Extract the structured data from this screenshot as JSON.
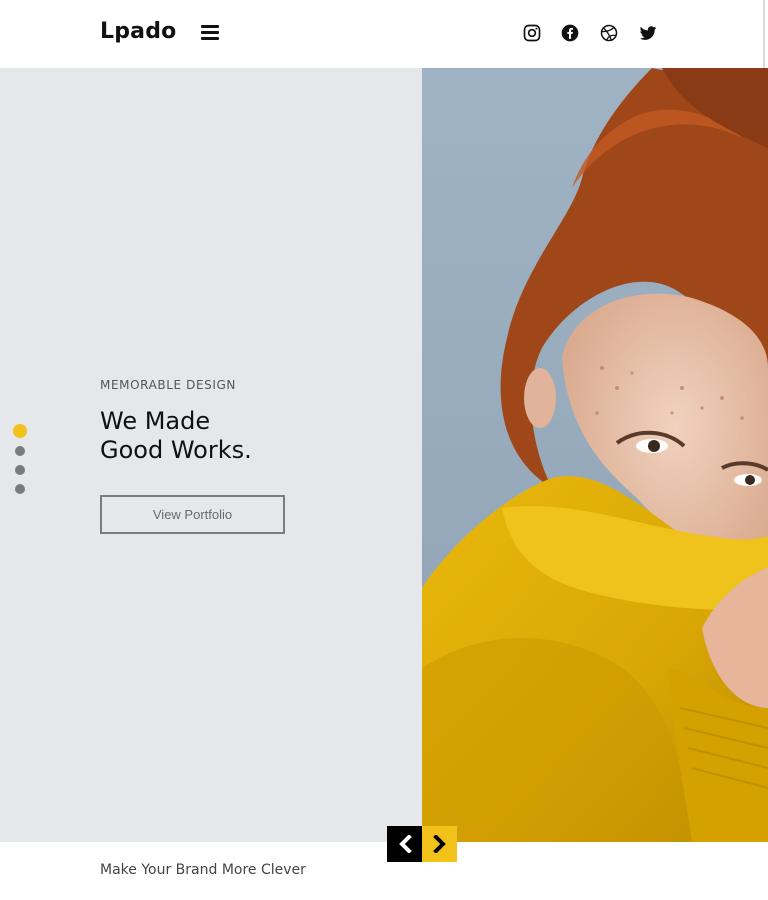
{
  "header": {
    "brand": "Lpado",
    "menu_icon": "hamburger-menu-icon",
    "social": [
      {
        "name": "instagram-icon"
      },
      {
        "name": "facebook-icon"
      },
      {
        "name": "dribbble-icon"
      },
      {
        "name": "twitter-icon"
      }
    ]
  },
  "hero": {
    "eyebrow": "MEMORABLE DESIGN",
    "title_line1": "We Made",
    "title_line2": "Good Works.",
    "cta_label": "View Portfolio",
    "slides": {
      "count": 4,
      "active": 1
    },
    "image": "woman-yellow-sweater-photo"
  },
  "nav": {
    "prev_icon": "chevron-left-icon",
    "next_icon": "chevron-right-icon"
  },
  "footer": {
    "tagline": "Make Your Brand More Clever"
  },
  "colors": {
    "accent": "#f2c21b",
    "hero_bg": "#e6e7ea",
    "text": "#111111"
  }
}
